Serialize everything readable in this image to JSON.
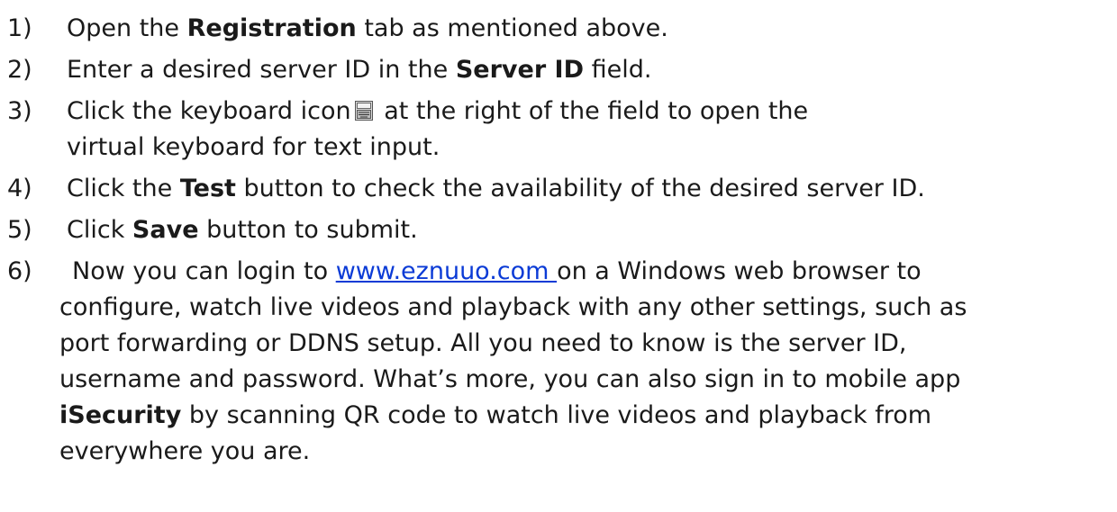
{
  "steps": [
    {
      "number": "1)",
      "pre": "Open the ",
      "bold": "Registration",
      "post": " tab as mentioned above."
    },
    {
      "number": "2)",
      "pre": "Enter a desired server ID in the ",
      "bold": "Server ID",
      "post": " field."
    },
    {
      "number": "3)",
      "pre": "Click the keyboard icon",
      "post": " at the right of the field to open the",
      "line2": "virtual keyboard for text input.",
      "icon": "keyboard-icon"
    },
    {
      "number": "4)",
      "pre": "Click the ",
      "bold": "Test",
      "post": " button to check the availability of the desired server ID."
    },
    {
      "number": "5)",
      "pre": "Click ",
      "bold": "Save",
      "post": " button to submit."
    },
    {
      "number": "6)",
      "pre": "Now you can login to ",
      "link": "www.eznuuo.com ",
      "post": "on a Windows web browser to",
      "lines": [
        "configure, watch live videos and playback with any other settings, such as",
        "port forwarding or DDNS setup. All you need to know is the server ID,",
        "username and password. What’s more, you can also sign in to mobile app"
      ],
      "bold_last": "iSecurity",
      "last_post": " by scanning QR code to watch live videos and playback from",
      "final_line": "everywhere you are."
    }
  ],
  "colors": {
    "text": "#1a1a1a",
    "link": "#0b3bd6"
  }
}
